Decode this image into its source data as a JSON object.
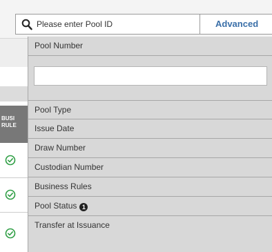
{
  "search": {
    "placeholder": "Please enter Pool ID",
    "advanced_label": "Advanced"
  },
  "background": {
    "column_header": "BUSI RULE",
    "row_icons": [
      "check-circle-icon",
      "check-circle-icon",
      "check-circle-icon"
    ]
  },
  "panel": {
    "pool_number_label": "Pool Number",
    "pool_number_value": "",
    "filters": [
      {
        "label": "Pool Type"
      },
      {
        "label": "Issue Date"
      },
      {
        "label": "Draw Number"
      },
      {
        "label": "Custodian Number"
      },
      {
        "label": "Business Rules"
      },
      {
        "label": "Pool Status",
        "badge": "1"
      },
      {
        "label": "Transfer at Issuance"
      }
    ]
  },
  "colors": {
    "accent": "#3a6fa8",
    "panel_bg": "#d8d8d8",
    "check_green": "#2e9e44"
  }
}
